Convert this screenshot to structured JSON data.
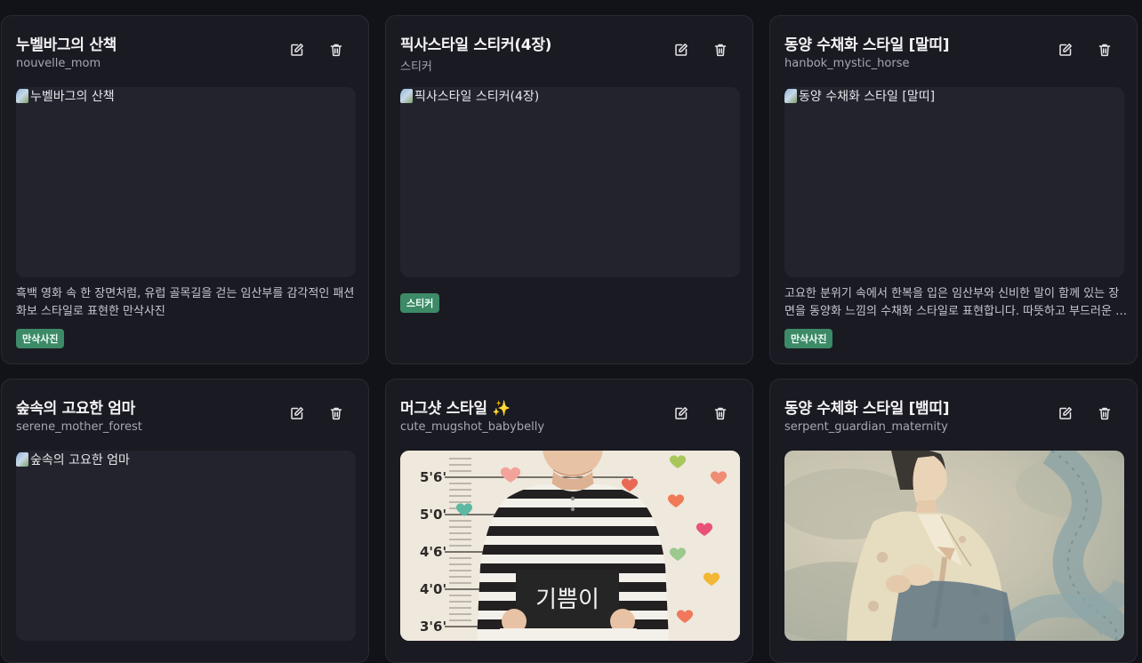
{
  "cards": [
    {
      "title": "누벨바그의 산책",
      "subtitle": "nouvelle_mom",
      "image_alt": "누벨바그의 산책",
      "description": "흑백 영화 속 한 장면처럼, 유럽 골목길을 걷는 임산부를 감각적인 패션 화보 스타일로 표현한 만삭사진",
      "tag": "만삭사진"
    },
    {
      "title": "픽사스타일 스티커(4장)",
      "subtitle": "스티커",
      "image_alt": "픽사스타일 스티커(4장)",
      "description": "",
      "tag": "스티커"
    },
    {
      "title": "동양 수채화 스타일 [말띠]",
      "subtitle": "hanbok_mystic_horse",
      "image_alt": "동양 수채화 스타일 [말띠]",
      "description": "고요한 분위기 속에서 한복을 입은 임산부와 신비한 말이 함께 있는 장면을 동양화 느낌의 수채화 스타일로 표현합니다. 따뜻하고 부드러운 색감이 돋보입니다.",
      "tag": "만삭사진"
    },
    {
      "title": "숲속의 고요한 엄마",
      "subtitle": "serene_mother_forest",
      "image_alt": "숲속의 고요한 엄마"
    },
    {
      "title": "머그샷 스타일 ✨",
      "subtitle": "cute_mugshot_babybelly",
      "image_heights": [
        "5'6'",
        "5'0'",
        "4'6'",
        "4'0'",
        "3'6'"
      ],
      "image_sign": "기쁨이"
    },
    {
      "title": "동양 수체화 스타일 [뱀띠]",
      "subtitle": "serpent_guardian_maternity"
    }
  ],
  "icons": {
    "edit": "edit-icon",
    "delete": "trash-icon"
  },
  "colors": {
    "background": "#121219",
    "card": "#1a1a22",
    "tag": "#3d8a67"
  }
}
